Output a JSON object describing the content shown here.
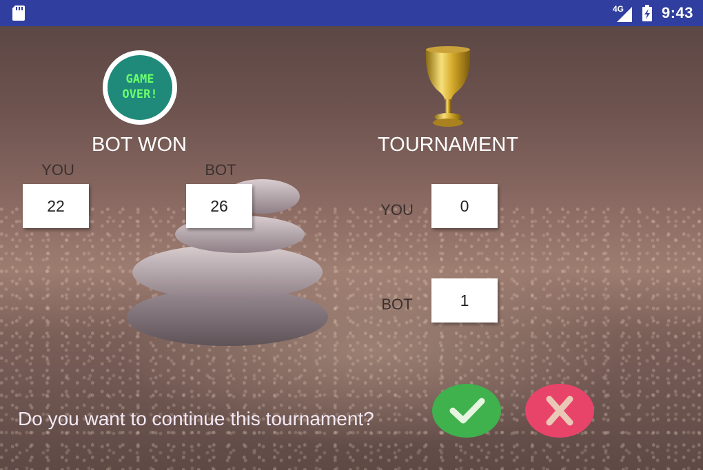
{
  "status_bar": {
    "network": "4G",
    "time": "9:43",
    "icons": [
      "sd-card-icon",
      "signal-icon",
      "battery-icon"
    ]
  },
  "result": {
    "badge_text": "GAME OVER!",
    "title": "BOT WON",
    "you_label": "YOU",
    "bot_label": "BOT",
    "you_score": "22",
    "bot_score": "26"
  },
  "tournament": {
    "icon": "trophy-icon",
    "title": "TOURNAMENT",
    "you_label": "YOU",
    "bot_label": "BOT",
    "you_score": "0",
    "bot_score": "1"
  },
  "prompt": {
    "question": "Do you want to continue this tournament?",
    "accept_icon": "checkmark-icon",
    "decline_icon": "x-icon"
  },
  "colors": {
    "status_bar": "#303f9f",
    "accept": "#3fb14d",
    "decline": "#e8446a",
    "badge_bg": "#1f8a7a",
    "badge_text": "#6cff6a"
  }
}
